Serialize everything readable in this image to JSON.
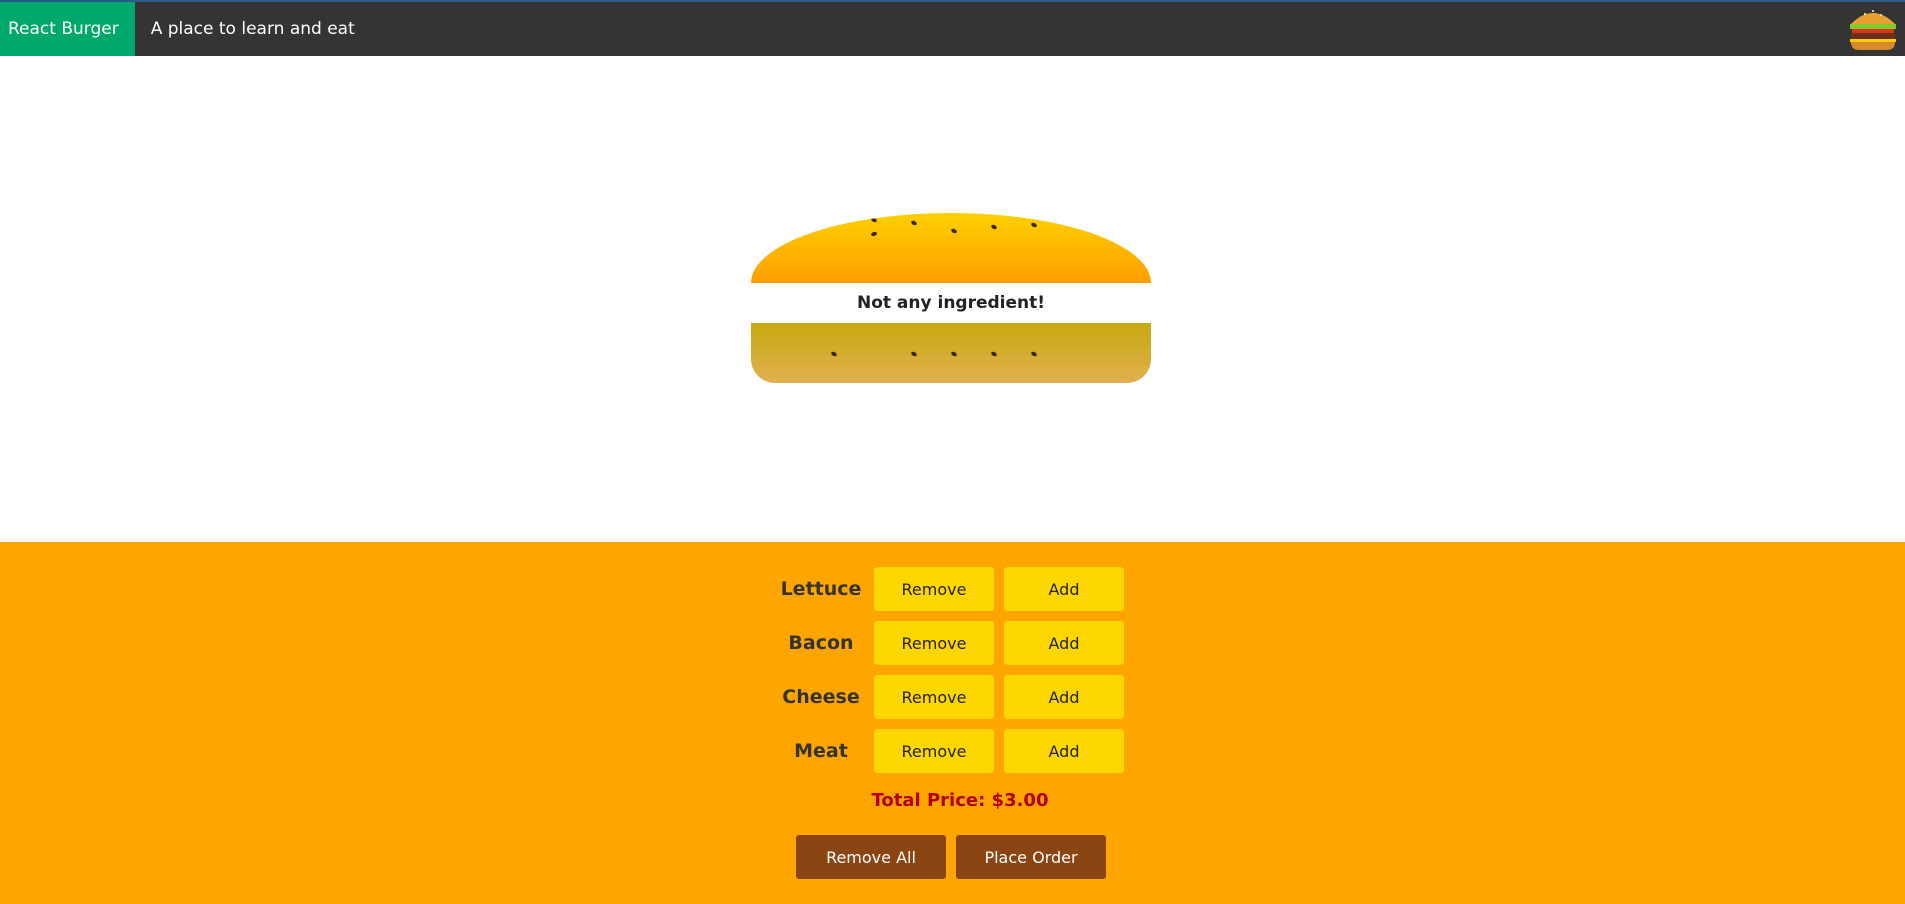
{
  "header": {
    "brand": "React Burger",
    "tagline": "A place to learn and eat",
    "logo_icon": "burger-icon"
  },
  "burger": {
    "message": "Not any ingredient!"
  },
  "controls": {
    "rows": [
      {
        "label": "Lettuce",
        "remove": "Remove",
        "add": "Add"
      },
      {
        "label": "Bacon",
        "remove": "Remove",
        "add": "Add"
      },
      {
        "label": "Cheese",
        "remove": "Remove",
        "add": "Add"
      },
      {
        "label": "Meat",
        "remove": "Remove",
        "add": "Add"
      }
    ],
    "total_price": "Total Price: $3.00",
    "remove_all": "Remove All",
    "place_order": "Place Order"
  },
  "colors": {
    "navbar": "#343434",
    "brand": "#00a86b",
    "controls_bg": "#ffa500",
    "button": "#ffd700",
    "order_button": "#8b4513",
    "price": "#b30000"
  }
}
